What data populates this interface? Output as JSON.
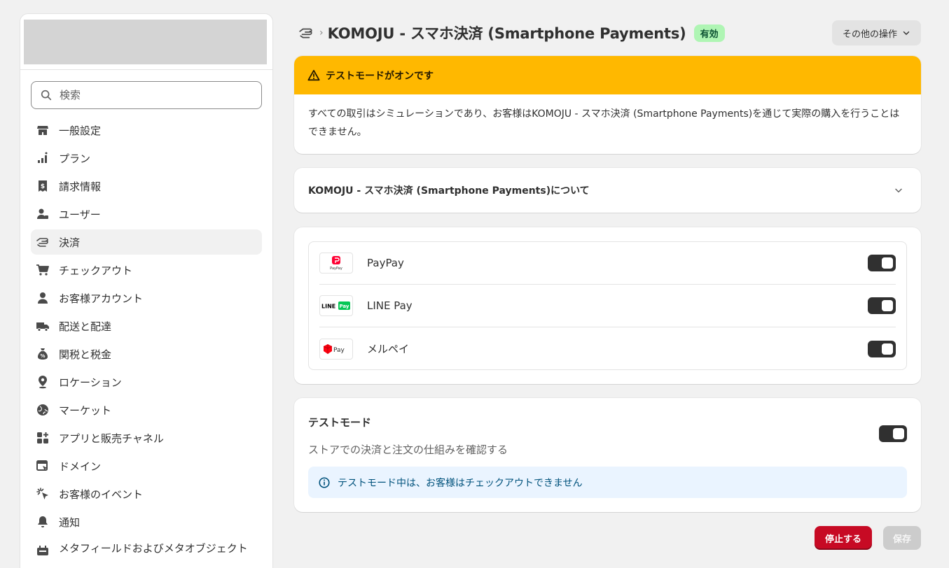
{
  "search": {
    "placeholder": "検索"
  },
  "sidebar": {
    "items": [
      {
        "label": "一般設定",
        "icon": "store-icon"
      },
      {
        "label": "プラン",
        "icon": "plan-icon"
      },
      {
        "label": "請求情報",
        "icon": "receipt-icon"
      },
      {
        "label": "ユーザー",
        "icon": "users-icon"
      },
      {
        "label": "決済",
        "icon": "payments-icon",
        "active": true
      },
      {
        "label": "チェックアウト",
        "icon": "cart-icon"
      },
      {
        "label": "お客様アカウント",
        "icon": "person-icon"
      },
      {
        "label": "配送と配達",
        "icon": "truck-icon"
      },
      {
        "label": "関税と税金",
        "icon": "tax-icon"
      },
      {
        "label": "ロケーション",
        "icon": "location-icon"
      },
      {
        "label": "マーケット",
        "icon": "globe-icon"
      },
      {
        "label": "アプリと販売チャネル",
        "icon": "apps-icon"
      },
      {
        "label": "ドメイン",
        "icon": "domain-icon"
      },
      {
        "label": "お客様のイベント",
        "icon": "cursor-click-icon"
      },
      {
        "label": "通知",
        "icon": "bell-icon"
      },
      {
        "label": "メタフィールドおよびメタオブジェクト",
        "icon": "metafields-icon"
      }
    ]
  },
  "header": {
    "title": "KOMOJU - スマホ決済 (Smartphone Payments)",
    "status": "有効",
    "more_actions": "その他の操作"
  },
  "banner": {
    "title": "テストモードがオンです",
    "body": "すべての取引はシミュレーションであり、お客様はKOMOJU - スマホ決済 (Smartphone Payments)を通じて実際の購入を行うことはできません。"
  },
  "about": {
    "title": "KOMOJU - スマホ決済 (Smartphone Payments)について"
  },
  "methods": [
    {
      "name": "PayPay",
      "enabled": true
    },
    {
      "name": "LINE Pay",
      "enabled": true
    },
    {
      "name": "メルペイ",
      "enabled": true
    }
  ],
  "logos": {
    "paypay_text": "PayPay",
    "linepay_line": "LINE",
    "linepay_pay": "Pay",
    "merpay_text": "Pay"
  },
  "test_mode": {
    "title": "テストモード",
    "description": "ストアでの決済と注文の仕組みを確認する",
    "enabled": true,
    "info": "テストモード中は、お客様はチェックアウトできません"
  },
  "footer": {
    "stop_label": "停止する",
    "save_label": "保存"
  },
  "colors": {
    "banner_bg": "#ffb800",
    "badge_bg": "#aff5b4",
    "stop_bg": "#c70a24",
    "info_bg": "#eaf4ff"
  }
}
